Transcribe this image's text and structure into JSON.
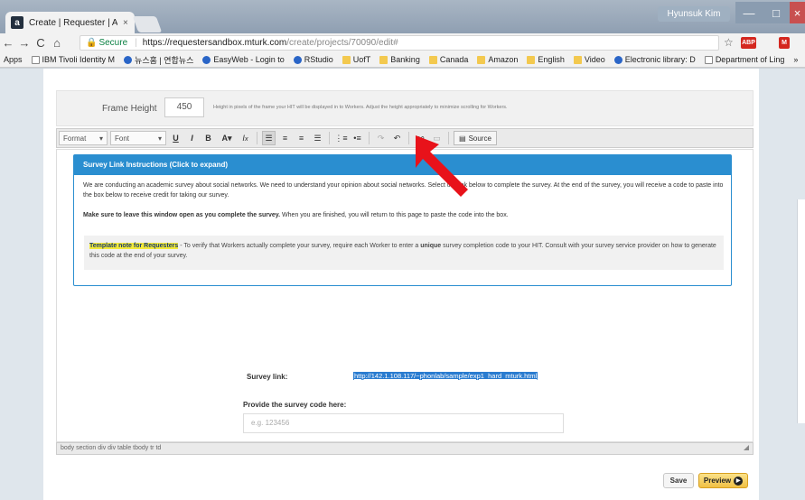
{
  "browser": {
    "tab_title": "Create | Requester | Am...",
    "tab_close": "×",
    "tab_favicon": "a",
    "user_name": "Hyunsuk Kim",
    "window_controls": {
      "minimize": "—",
      "maximize": "□",
      "close": "×"
    },
    "nav": {
      "back": "←",
      "forward": "→",
      "reload": "C",
      "home": "⌂"
    },
    "secure_label": "Secure",
    "url_host": "https://requestersandbox.mturk.com",
    "url_path": "/create/projects/70090/edit#",
    "star": "☆",
    "extensions": [
      "ABP",
      "M"
    ],
    "bookmarks": [
      {
        "label": "Apps",
        "icon": "apps-icon"
      },
      {
        "label": "IBM Tivoli Identity M",
        "icon": "page-icon"
      },
      {
        "label": "뉴스홈 | 연합뉴스",
        "icon": "globe-icon"
      },
      {
        "label": "EasyWeb - Login to",
        "icon": "td-icon"
      },
      {
        "label": "RStudio",
        "icon": "rstudio-icon"
      },
      {
        "label": "UofT",
        "icon": "folder-icon"
      },
      {
        "label": "Banking",
        "icon": "folder-icon"
      },
      {
        "label": "Canada",
        "icon": "folder-icon"
      },
      {
        "label": "Amazon",
        "icon": "folder-icon"
      },
      {
        "label": "English",
        "icon": "folder-icon"
      },
      {
        "label": "Video",
        "icon": "folder-icon"
      },
      {
        "label": "Electronic library: D",
        "icon": "globe-icon"
      },
      {
        "label": "Department of Ling",
        "icon": "page-icon"
      },
      {
        "label": "»",
        "icon": "more-icon"
      }
    ]
  },
  "frame_height": {
    "label": "Frame Height",
    "value": "450",
    "help": "Height in pixels of the frame your HIT will be displayed in to Workers. Adjust the height appropriately to minimize scrolling for Workers."
  },
  "toolbar": {
    "format": "Format",
    "font": "Font",
    "source": "Source"
  },
  "panel": {
    "title": "Survey Link Instructions (Click to expand)",
    "p1": "We are conducting an academic survey about social networks. We need to understand your opinion about social networks. Select the link below to complete the survey. At the end of the survey, you will receive a code to paste into the box below to receive credit for taking our survey.",
    "p2_bold": "Make sure to leave this window open as you complete the survey.",
    "p2_rest": " When you are finished, you will return to this page to paste the code into the box.",
    "note_highlight": "Template note for Requesters",
    "note_text_a": " - To verify that Workers actually complete your survey, require each Worker to enter a ",
    "note_bold": "unique",
    "note_text_b": " survey completion code to your HIT. Consult with your survey service provider on how to generate this code at the end of your survey."
  },
  "survey": {
    "link_label": "Survey link:",
    "link_url": "http://142.1.108.117/~phonlab/sample/exp1_hard_mturk.html",
    "code_label": "Provide the survey code here:",
    "code_placeholder": "e.g. 123456"
  },
  "pathbar": "body  section  div  div  table  tbody  tr  td",
  "actions": {
    "save": "Save",
    "preview": "Preview"
  },
  "colors": {
    "panel_blue": "#2a8ed0",
    "highlight": "#f3ea3a",
    "preview_yellow": "#f0c044",
    "annotation_arrow": "#e8121a"
  }
}
